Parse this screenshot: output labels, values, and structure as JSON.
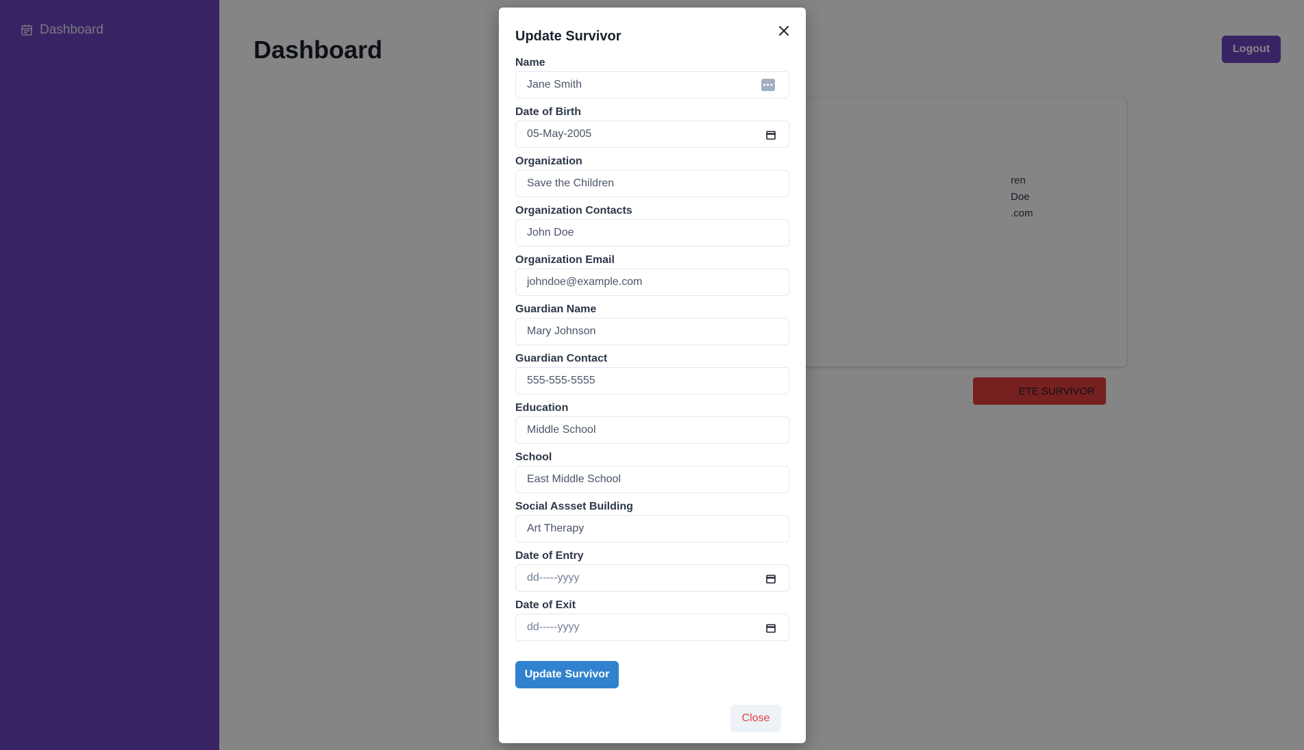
{
  "sidebar": {
    "items": [
      {
        "label": "Dashboard",
        "icon": "calendar-icon"
      }
    ],
    "color": "#6b46c1"
  },
  "header": {
    "title": "Dashboard",
    "logout_label": "Logout"
  },
  "background_card": {
    "lines": [
      "ren",
      "Doe",
      ".com"
    ],
    "delete_label": "ETE SURVIVOR"
  },
  "modal": {
    "title": "Update Survivor",
    "fields": [
      {
        "label": "Name",
        "value": "Jane Smith",
        "type": "text"
      },
      {
        "label": "Date of Birth",
        "value": "05-May-2005",
        "type": "date"
      },
      {
        "label": "Organization",
        "value": "Save the Children",
        "type": "text"
      },
      {
        "label": "Organization Contacts",
        "value": "John Doe",
        "type": "text"
      },
      {
        "label": "Organization Email",
        "value": "johndoe@example.com",
        "type": "text"
      },
      {
        "label": "Guardian Name",
        "value": "Mary Johnson",
        "type": "text"
      },
      {
        "label": "Guardian Contact",
        "value": "555-555-5555",
        "type": "text"
      },
      {
        "label": "Education",
        "value": "Middle School",
        "type": "text"
      },
      {
        "label": "School",
        "value": "East Middle School",
        "type": "text"
      },
      {
        "label": "Social Assset Building",
        "value": "Art Therapy",
        "type": "text"
      },
      {
        "label": "Date of Entry",
        "value": "dd-----yyyy",
        "type": "date",
        "placeholder": true
      },
      {
        "label": "Date of Exit",
        "value": "dd-----yyyy",
        "type": "date",
        "placeholder": true
      }
    ],
    "submit_label": "Update Survivor",
    "close_label": "Close"
  },
  "colors": {
    "accent": "#6b46c1",
    "primary_button": "#3182ce",
    "danger": "#e53e3e"
  }
}
